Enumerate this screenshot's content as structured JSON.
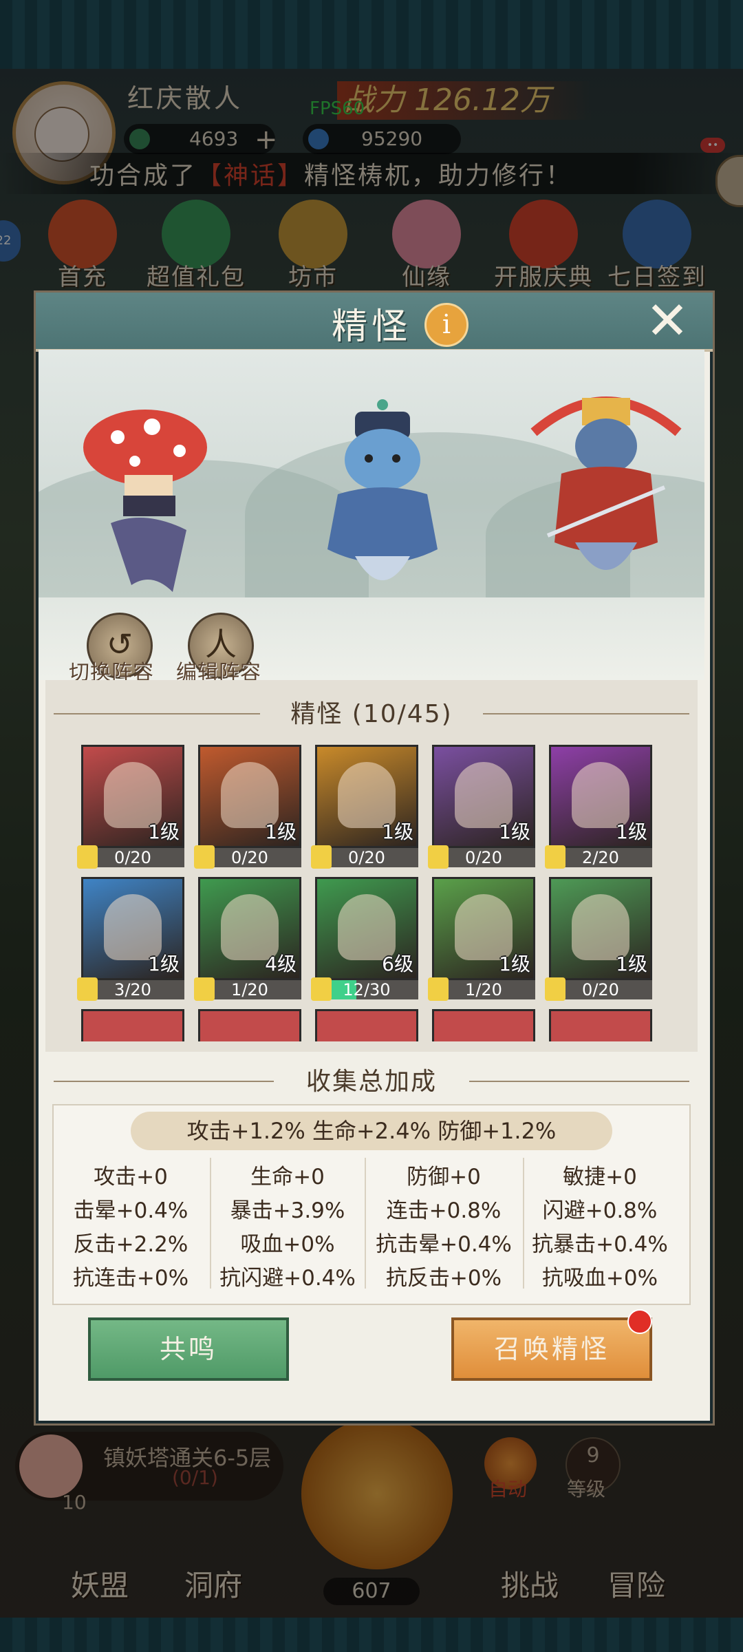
{
  "hud": {
    "player_name": "红庆散人",
    "fps": "FPS60",
    "power": "战力 126.12万",
    "jade": "4693",
    "gems": "95290",
    "plus": "+",
    "chat_badge": "••"
  },
  "marquee": {
    "prefix": "功合成了",
    "tag": "【神话】",
    "suffix": "精怪梼杌，助力修行！"
  },
  "left_bubble": "22",
  "features": [
    "首充",
    "超值礼包",
    "坊市",
    "仙缘",
    "开服庆典",
    "七日签到"
  ],
  "dialog": {
    "title": "精怪",
    "info": "i",
    "close": "✕",
    "switch_team": "切换阵容",
    "edit_team": "编辑阵容",
    "collection_title": "精怪 (10/45)",
    "bonus_title": "收集总加成",
    "resonate": "共鸣",
    "summon": "召唤精怪"
  },
  "cards": [
    {
      "level": "1级",
      "progress": "0/20",
      "ratio": 0,
      "bg": "#c24b4b"
    },
    {
      "level": "1级",
      "progress": "0/20",
      "ratio": 0,
      "bg": "#c05a2e"
    },
    {
      "level": "1级",
      "progress": "0/20",
      "ratio": 0,
      "bg": "#c98a2a"
    },
    {
      "level": "1级",
      "progress": "0/20",
      "ratio": 0,
      "bg": "#7a4fa0"
    },
    {
      "level": "1级",
      "progress": "2/20",
      "ratio": 0.1,
      "bg": "#8e3fa8"
    },
    {
      "level": "1级",
      "progress": "3/20",
      "ratio": 0.15,
      "bg": "#3f84c6"
    },
    {
      "level": "4级",
      "progress": "1/20",
      "ratio": 0.05,
      "bg": "#3f9a4f"
    },
    {
      "level": "6级",
      "progress": "12/30",
      "ratio": 0.4,
      "bg": "#3f9a4f"
    },
    {
      "level": "1级",
      "progress": "1/20",
      "ratio": 0.05,
      "bg": "#5aa04a"
    },
    {
      "level": "1级",
      "progress": "0/20",
      "ratio": 0,
      "bg": "#4e9a56"
    }
  ],
  "bonus_summary": "攻击+1.2%    生命+2.4%    防御+1.2%",
  "stats": [
    [
      "攻击+0",
      "生命+0",
      "防御+0",
      "敏捷+0"
    ],
    [
      "击晕+0.4%",
      "暴击+3.9%",
      "连击+0.8%",
      "闪避+0.8%"
    ],
    [
      "反击+2.2%",
      "吸血+0%",
      "抗击晕+0.4%",
      "抗暴击+0.4%"
    ],
    [
      "抗连击+0%",
      "抗闪避+0.4%",
      "抗反击+0%",
      "抗吸血+0%"
    ]
  ],
  "bottom": {
    "task": "镇妖塔通关6-5层",
    "task_progress": "(0/1)",
    "task_count": "10",
    "auto": "自动",
    "level_num": "9",
    "level_label": "等级",
    "coins": "607",
    "nav": [
      "妖盟",
      "洞府",
      "挑战",
      "冒险"
    ]
  }
}
